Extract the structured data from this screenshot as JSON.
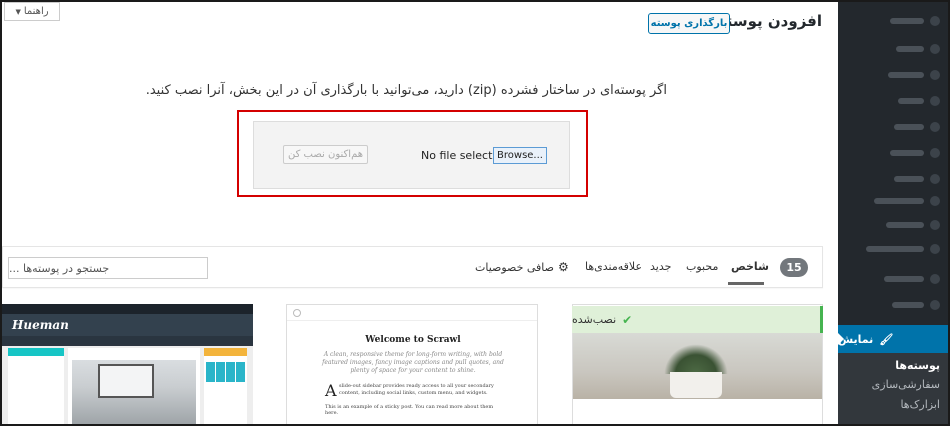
{
  "help_tab": {
    "label": "راهنما",
    "arrow": "▼"
  },
  "page": {
    "title": "افزودن پوسته‌ها",
    "upload_button": "بارگذاری پوسته",
    "description": "اگر پوسته‌ای در ساختار فشرده (zip) دارید، می‌توانید با بارگذاری آن در این بخش، آنرا نصب کنید."
  },
  "upload_form": {
    "browse_label": "Browse...",
    "file_status": "No file selected.",
    "install_button": "هم‌اکنون نصب کن"
  },
  "filter_bar": {
    "count": "15",
    "tabs": [
      {
        "label": "شاخص",
        "active": true
      },
      {
        "label": "محبوب"
      },
      {
        "label": "جدید"
      },
      {
        "label": "علاقه‌مندی‌ها"
      },
      {
        "label": "صافی خصوصیات",
        "icon": "gear-icon"
      }
    ],
    "search_placeholder": "جستجو در پوسته‌ها ..."
  },
  "themes": [
    {
      "preview": {
        "logo": "Hueman"
      }
    },
    {
      "preview": {
        "welcome": "Welcome to Scrawl",
        "tagline": "A clean, responsive theme for long-form writing, with bold featured images, fancy image captions and pull quotes, and plenty of space for your content to shine.",
        "dropcap": "A",
        "excerpt": "slide-out sidebar provides ready access to all your secondary content, including social links, custom menu, and widgets.",
        "excerpt2": "This is an example of a sticky post. You can read more about them here."
      }
    },
    {
      "installed_label": "نصب‌شده",
      "installed_icon": "check-icon"
    }
  ],
  "sidebar": {
    "active": "نمایش",
    "active_icon": "paintbrush-icon",
    "submenu": [
      {
        "label": "پوسته‌ها",
        "current": true
      },
      {
        "label": "سفارشی‌سازی"
      },
      {
        "label": "ابزارک‌ها"
      }
    ]
  },
  "colors": {
    "accent": "#0073aa",
    "sidebar_bg": "#23282d",
    "installed_green": "#46b450",
    "highlight_red": "#d40000"
  }
}
